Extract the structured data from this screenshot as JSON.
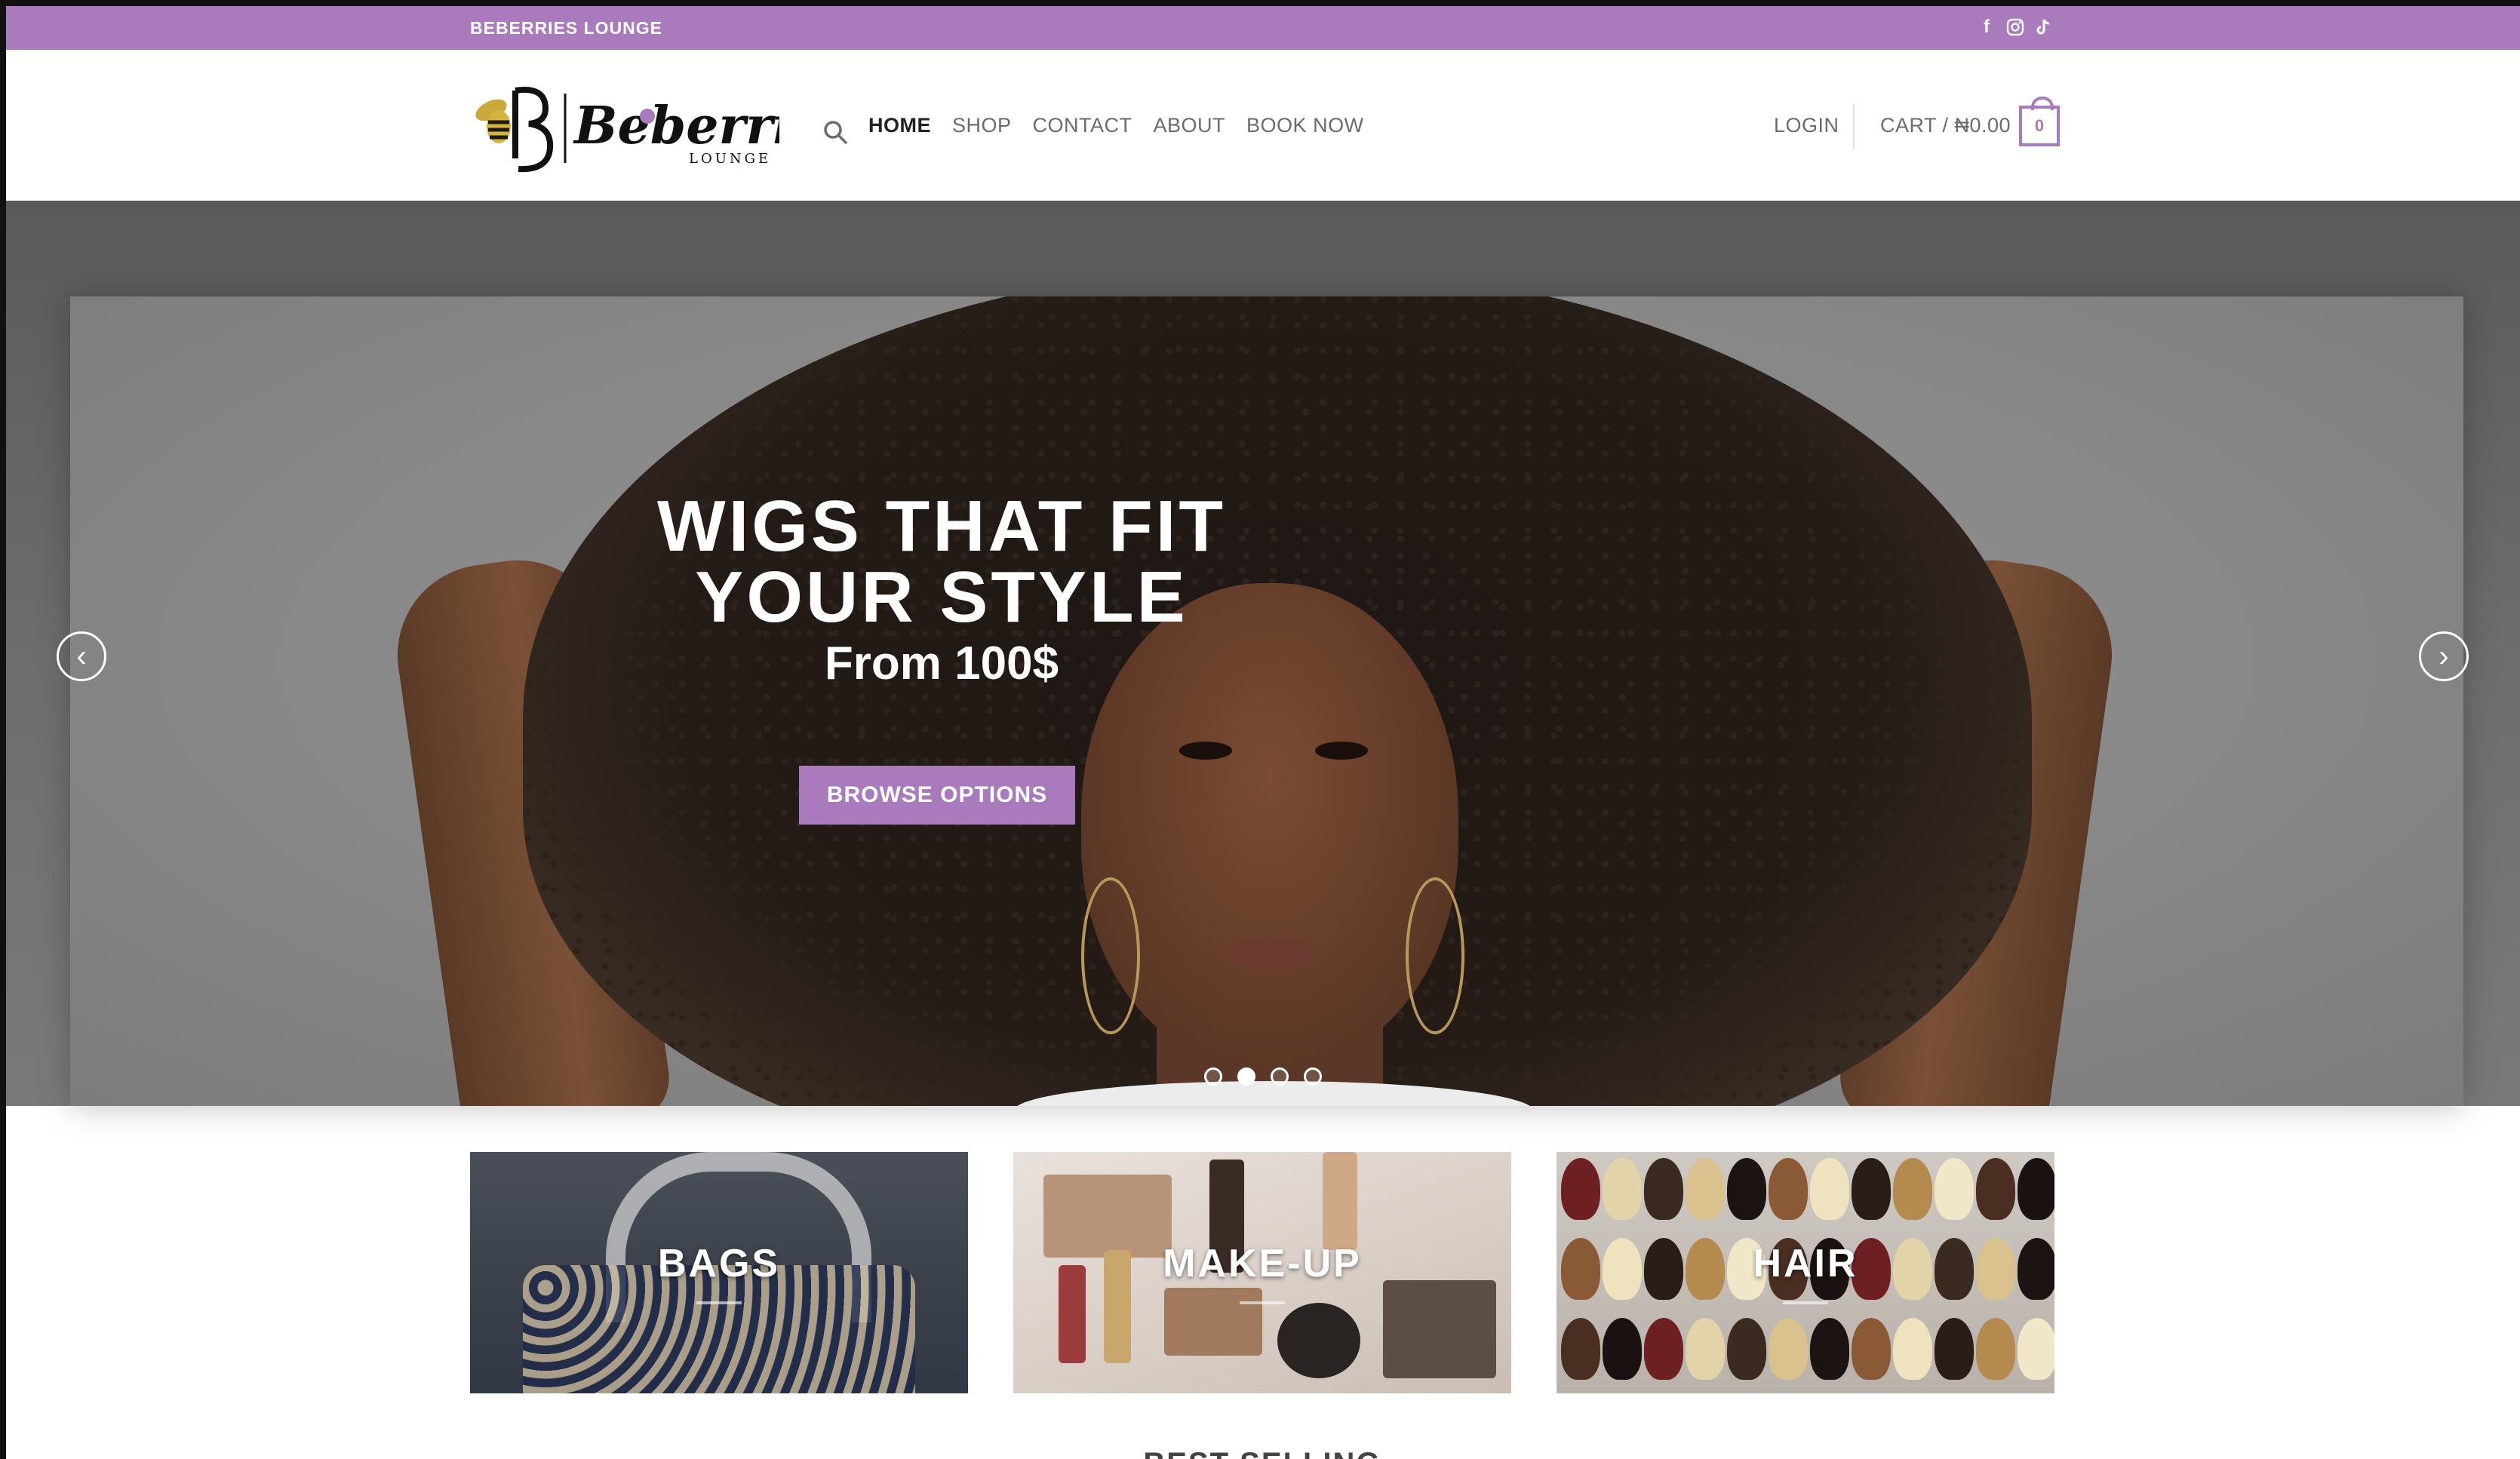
{
  "topbar": {
    "brand": "BEBERRIES LOUNGE",
    "social": [
      "facebook-icon",
      "instagram-icon",
      "tiktok-icon"
    ]
  },
  "header": {
    "logo_text": "Beberries",
    "logo_sub": "LOUNGE",
    "nav": [
      "HOME",
      "SHOP",
      "CONTACT",
      "ABOUT",
      "BOOK NOW"
    ],
    "active_nav": "HOME",
    "login": "LOGIN",
    "cart_label": "CART / ₦0.00",
    "cart_count": "0"
  },
  "hero": {
    "headline_line1": "WIGS THAT FIT",
    "headline_line2": "YOUR STYLE",
    "subheadline": "From 100$",
    "cta": "BROWSE OPTIONS",
    "slide_count": 4,
    "active_slide": 2
  },
  "categories": [
    "BAGS",
    "MAKE-UP",
    "HAIR"
  ],
  "section_title": "BEST SELLING PRODUCTS",
  "colors": {
    "accent": "#a97bbd",
    "text_dark": "#222222",
    "text_nav": "#6b6b6b"
  }
}
